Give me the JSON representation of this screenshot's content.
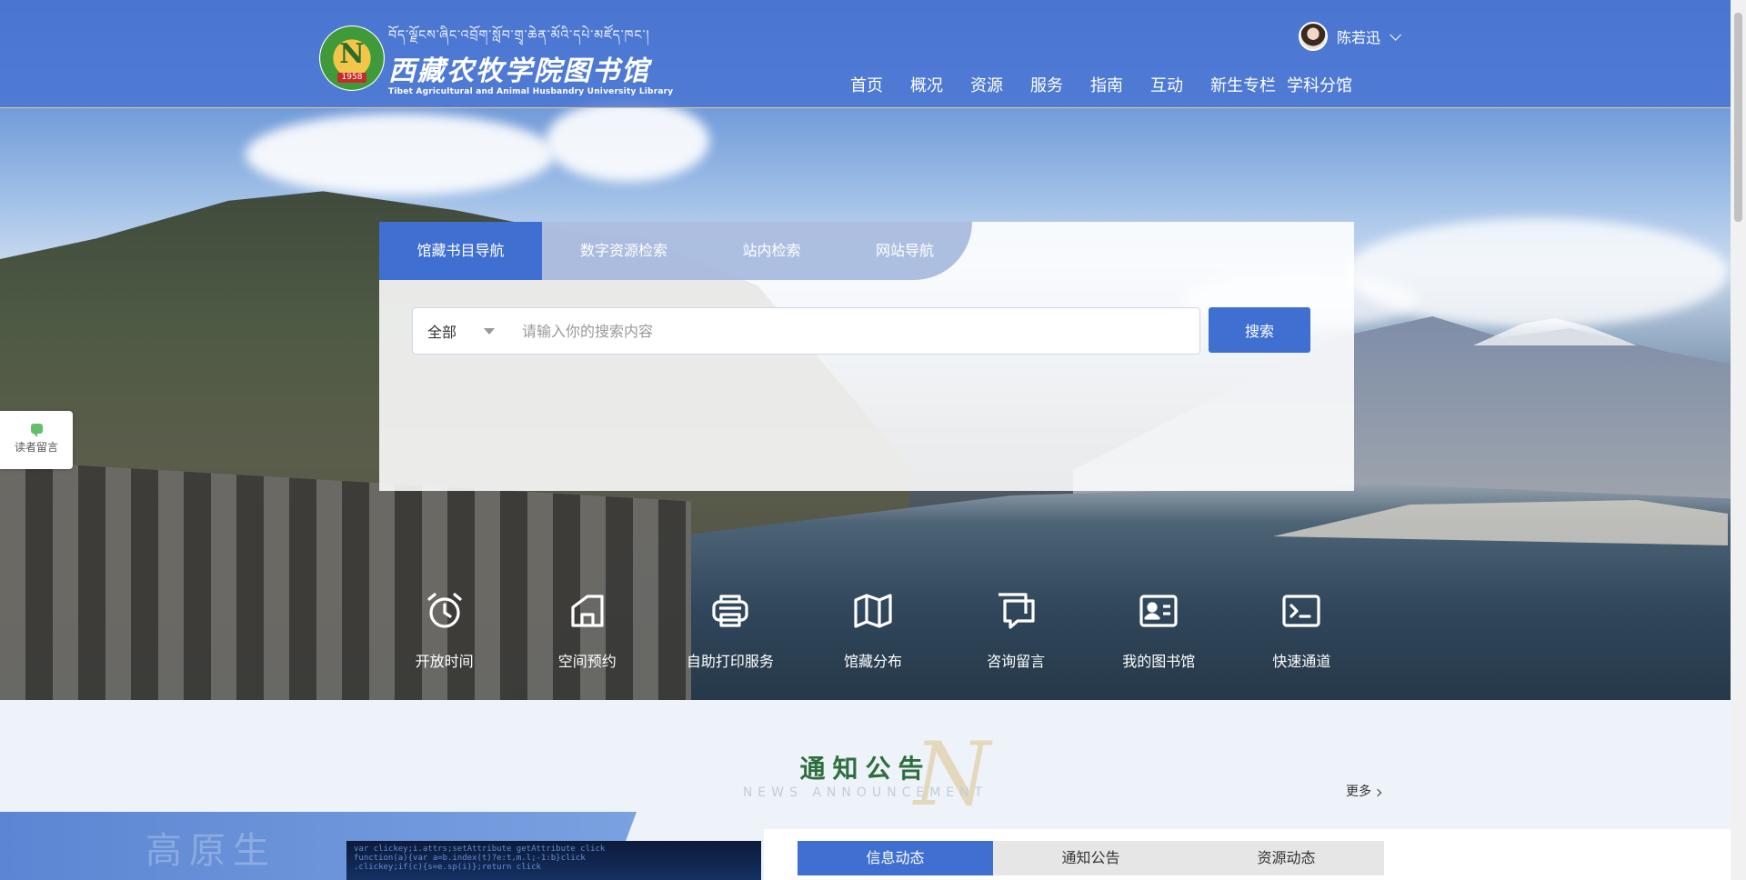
{
  "header": {
    "logo": {
      "tibetan": "བོད་ལྗོངས་ཞིང་འབྲོག་སློབ་གྲྭ་ཆེན་མོའི་དཔེ་མཛོད་ཁང་།",
      "name_cn": "西藏农牧学院图书馆",
      "name_en": "Tibet Agricultural and Animal Husbandry University Library",
      "emblem_letter": "N",
      "emblem_year": "1958"
    },
    "user": {
      "name": "陈若迅"
    },
    "nav": [
      "首页",
      "概况",
      "资源",
      "服务",
      "指南",
      "互动",
      "新生专栏",
      "学科分馆"
    ]
  },
  "search": {
    "tabs": [
      {
        "label": "馆藏书目导航",
        "active": true
      },
      {
        "label": "数字资源检索",
        "active": false
      },
      {
        "label": "站内检索",
        "active": false
      },
      {
        "label": "网站导航",
        "active": false
      }
    ],
    "scope": "全部",
    "placeholder": "请输入你的搜索内容",
    "value": "",
    "button": "搜索"
  },
  "float": {
    "label": "读者留言"
  },
  "quick_links": [
    {
      "label": "开放时间",
      "icon": "alarm-clock-icon"
    },
    {
      "label": "空间预约",
      "icon": "space-booking-icon"
    },
    {
      "label": "自助打印服务",
      "icon": "printer-icon"
    },
    {
      "label": "馆藏分布",
      "icon": "map-icon"
    },
    {
      "label": "咨询留言",
      "icon": "chat-icon"
    },
    {
      "label": "我的图书馆",
      "icon": "id-card-icon"
    },
    {
      "label": "快速通道",
      "icon": "terminal-icon"
    }
  ],
  "news": {
    "title": "通知公告",
    "subtitle": "NEWS ANNOUNCEMENT",
    "more": "更多",
    "bg_text": "高原生",
    "tabs": [
      {
        "label": "信息动态",
        "active": true
      },
      {
        "label": "通知公告",
        "active": false
      },
      {
        "label": "资源动态",
        "active": false
      }
    ]
  },
  "colors": {
    "primary": "#3f6fd1",
    "header_bg": "#4a76d4",
    "title_green": "#2e6e3e",
    "accent_gold": "#e6c58a"
  }
}
